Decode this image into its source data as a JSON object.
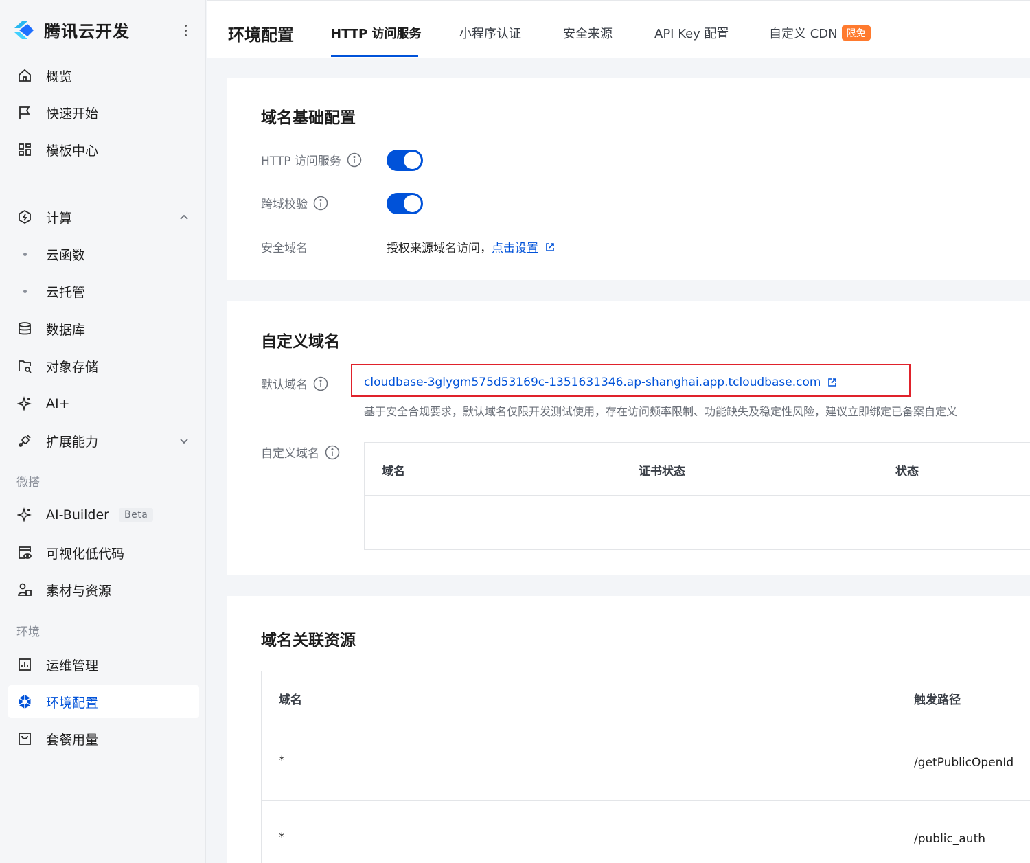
{
  "sidebar": {
    "brand": "腾讯云开发",
    "items": [
      {
        "label": "概览",
        "icon": "home-icon"
      },
      {
        "label": "快速开始",
        "icon": "flag-icon"
      },
      {
        "label": "模板中心",
        "icon": "grid-icon"
      },
      {
        "label": "计算",
        "icon": "compute-icon"
      },
      {
        "label": "云函数"
      },
      {
        "label": "云托管"
      },
      {
        "label": "数据库",
        "icon": "database-icon"
      },
      {
        "label": "对象存储",
        "icon": "storage-icon"
      },
      {
        "label": "AI+",
        "icon": "sparkle-icon"
      },
      {
        "label": "扩展能力",
        "icon": "extension-icon"
      },
      {
        "label": "AI-Builder",
        "icon": "sparkle-icon",
        "badge": "Beta"
      },
      {
        "label": "可视化低代码",
        "icon": "lowcode-icon"
      },
      {
        "label": "素材与资源",
        "icon": "assets-icon"
      },
      {
        "label": "运维管理",
        "icon": "chart-icon"
      },
      {
        "label": "环境配置",
        "icon": "settings-icon"
      },
      {
        "label": "套餐用量",
        "icon": "package-icon"
      }
    ],
    "sections": {
      "weida": "微搭",
      "env": "环境"
    }
  },
  "topbar": {
    "title": "环境配置",
    "tabs": [
      "HTTP 访问服务",
      "小程序认证",
      "安全来源",
      "API Key 配置",
      "自定义 CDN"
    ],
    "badge": "限免"
  },
  "basic": {
    "title": "域名基础配置",
    "http_label": "HTTP 访问服务",
    "cors_label": "跨域校验",
    "safe_label": "安全域名",
    "safe_text": "授权来源域名访问，",
    "safe_link": "点击设置"
  },
  "custom": {
    "title": "自定义域名",
    "default_label": "默认域名",
    "default_domain": "cloudbase-3glygm575d53169c-1351631346.ap-shanghai.app.tcloudbase.com",
    "hint": "基于安全合规要求，默认域名仅限开发测试使用，存在访问频率限制、功能缺失及稳定性风险，建议立即绑定已备案自定义",
    "custom_label": "自定义域名",
    "columns": [
      "域名",
      "证书状态",
      "状态"
    ]
  },
  "resources": {
    "title": "域名关联资源",
    "columns": [
      "域名",
      "触发路径"
    ],
    "rows": [
      {
        "domain": "*",
        "path": "/getPublicOpenId"
      },
      {
        "domain": "*",
        "path": "/public_auth"
      }
    ]
  },
  "colors": {
    "accent": "#0052d9",
    "highlight": "#e0222b",
    "badge": "#ff7a2e"
  }
}
